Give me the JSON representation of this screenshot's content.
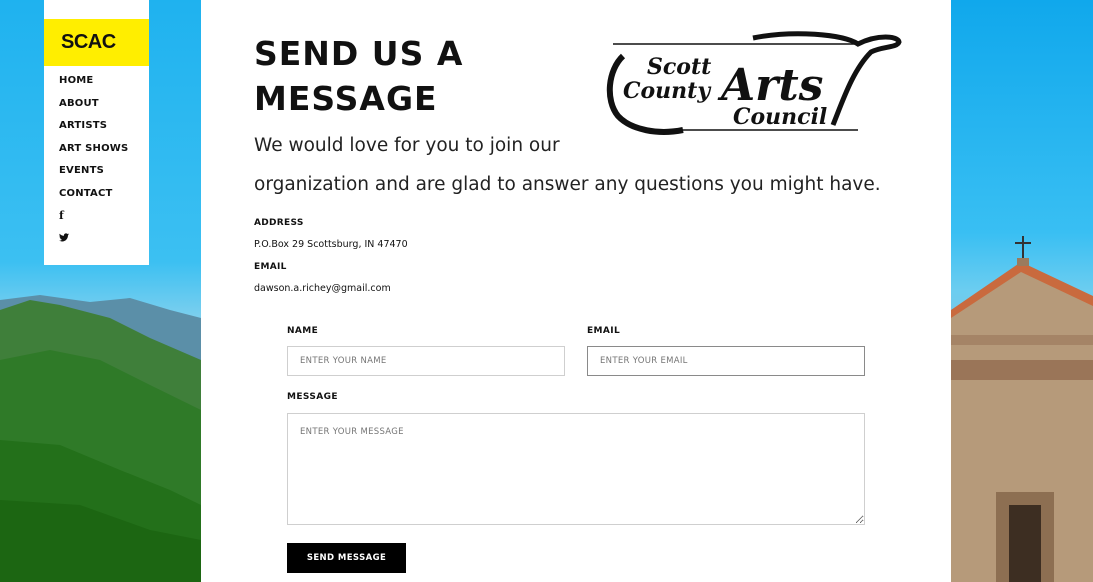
{
  "sidebar": {
    "brand": "SCAC",
    "nav": [
      "HOME",
      "ABOUT",
      "ARTISTS",
      "ART SHOWS",
      "EVENTS",
      "CONTACT"
    ],
    "social": {
      "facebook": "f",
      "twitter": "🐦"
    }
  },
  "main": {
    "heading": "SEND US A MESSAGE",
    "logo": {
      "line1": "Scott",
      "line2": "County",
      "line3": "Arts",
      "line4": "Council"
    },
    "intro_line1": "We would love for you to join our",
    "intro_line2": "organization and are glad to answer any questions you might have.",
    "address_label": "ADDRESS",
    "address_value": "P.O.Box 29 Scottsburg, IN 47470",
    "email_label": "EMAIL",
    "email_value": "dawson.a.richey@gmail.com"
  },
  "form": {
    "name_label": "NAME",
    "name_placeholder": "ENTER YOUR NAME",
    "email_label": "EMAIL",
    "email_placeholder": "ENTER YOUR EMAIL",
    "message_label": "MESSAGE",
    "message_placeholder": "ENTER YOUR MESSAGE",
    "submit_label": "SEND MESSAGE"
  },
  "colors": {
    "brand_bg": "#ffee00",
    "button_bg": "#000000",
    "sky": "#2bb5ec"
  }
}
